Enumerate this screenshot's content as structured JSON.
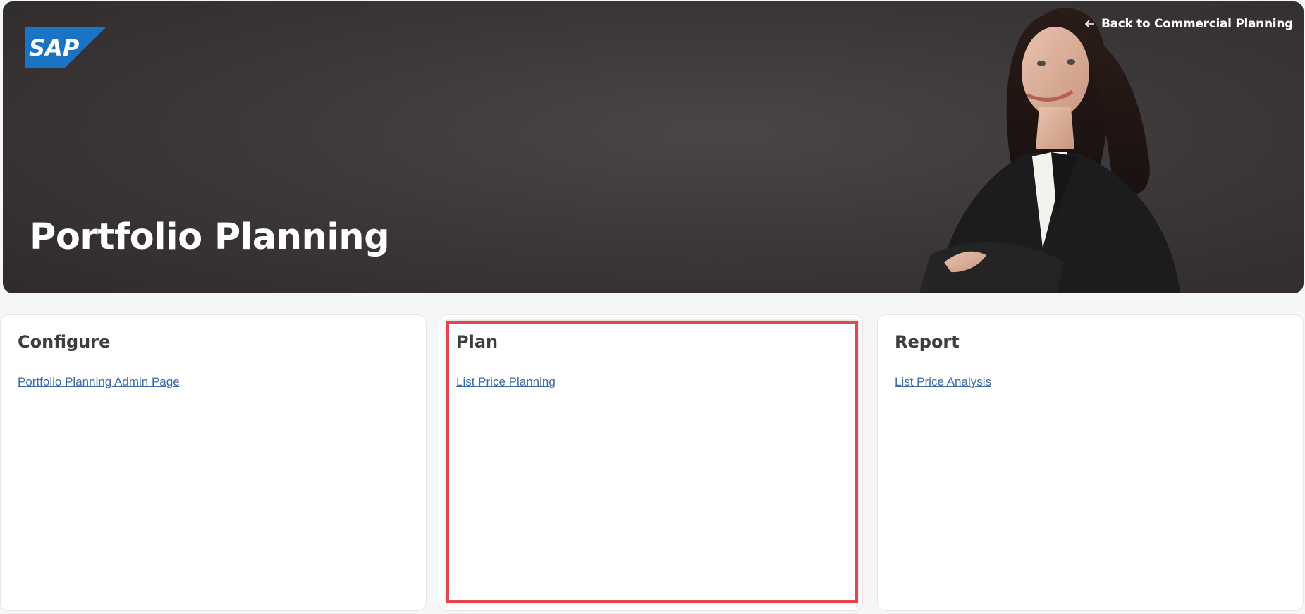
{
  "header": {
    "logo_text": "SAP",
    "back_link_label": "Back to Commercial Planning",
    "title": "Portfolio Planning"
  },
  "cards": [
    {
      "title": "Configure",
      "link_label": "Portfolio Planning Admin Page"
    },
    {
      "title": "Plan",
      "link_label": "List Price Planning"
    },
    {
      "title": "Report",
      "link_label": "List Price Analysis"
    }
  ],
  "colors": {
    "hero_background": "#3d393a",
    "link": "#3b6aa8",
    "highlight": "#e5454d",
    "sap_blue": "#1b73c4"
  }
}
